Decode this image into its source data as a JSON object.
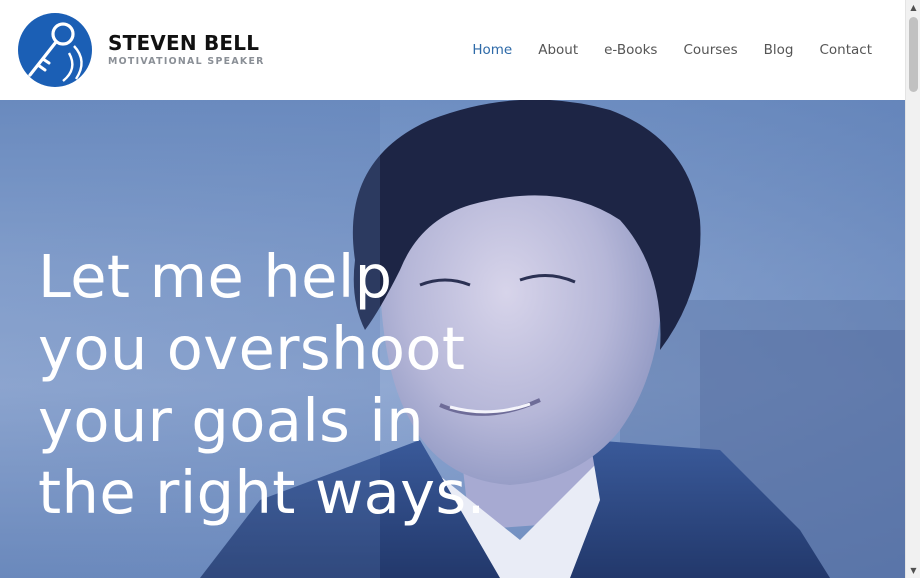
{
  "header": {
    "brand_name": "STEVEN BELL",
    "brand_tagline": "MOTIVATIONAL SPEAKER",
    "logo_icon": "key-globe-logo",
    "brand_color": "#1b5fb5"
  },
  "nav": {
    "items": [
      {
        "label": "Home",
        "active": true
      },
      {
        "label": "About",
        "active": false
      },
      {
        "label": "e-Books",
        "active": false
      },
      {
        "label": "Courses",
        "active": false
      },
      {
        "label": "Blog",
        "active": false
      },
      {
        "label": "Contact",
        "active": false
      }
    ],
    "active_color": "#2e6aa8"
  },
  "hero": {
    "headline_lines": [
      "Let me help",
      "you overshoot",
      "your goals in",
      "the right ways."
    ],
    "subline": "",
    "image": "portrait-photo"
  },
  "scrollbar": {
    "up_icon": "scroll-up-arrow-icon",
    "down_icon": "scroll-down-arrow-icon"
  }
}
